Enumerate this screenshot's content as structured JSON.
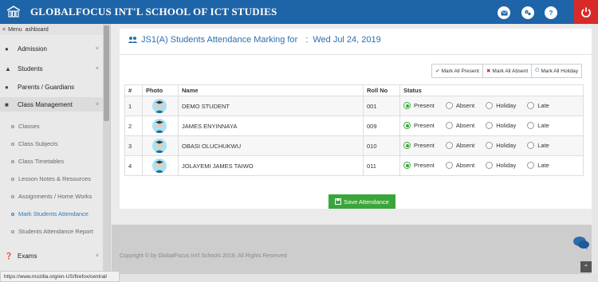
{
  "topbar": {
    "school_name": "GLOBALFOCUS INT'L SCHOOL OF ICT STUDIES",
    "icons": [
      "mail-icon",
      "settings-icon",
      "help-icon",
      "power-icon"
    ],
    "help_glyph": "?"
  },
  "sidebar": {
    "menu_label": "Menu",
    "menu_partial": "ashboard",
    "items": [
      {
        "label": "Admission",
        "icon": "user-icon",
        "has_arrow": true
      },
      {
        "label": "Students",
        "icon": "graduation-cap-icon",
        "has_arrow": true
      },
      {
        "label": "Parents / Guardians",
        "icon": "users-icon",
        "has_arrow": false
      },
      {
        "label": "Class Management",
        "icon": "sitemap-icon",
        "has_arrow": true
      },
      {
        "label": "Exams",
        "icon": "question-icon",
        "has_arrow": true
      }
    ],
    "subitems": [
      {
        "label": "Classes"
      },
      {
        "label": "Class Subjects"
      },
      {
        "label": "Class Timetables"
      },
      {
        "label": "Lesson Notes & Resources"
      },
      {
        "label": "Assignments / Home Works"
      },
      {
        "label": "Mark Students Attendance",
        "active": true
      },
      {
        "label": "Students Attendance Report"
      }
    ]
  },
  "page": {
    "title": "JS1(A) Students Attendance Marking for",
    "title_sep": ":",
    "date": "Wed Jul 24, 2019"
  },
  "mark_buttons": {
    "present": "Mark All Present",
    "absent": "Mark All Absent",
    "holiday": "Mark All Holiday"
  },
  "table": {
    "headers": [
      "#",
      "Photo",
      "Name",
      "Roll No",
      "Status"
    ],
    "status_options": [
      "Present",
      "Absent",
      "Holiday",
      "Late"
    ],
    "rows": [
      {
        "num": "1",
        "name": "DEMO STUDENT",
        "roll": "001",
        "status": "Present"
      },
      {
        "num": "2",
        "name": "JAMES ENYINNAYA",
        "roll": "009",
        "status": "Present"
      },
      {
        "num": "3",
        "name": "OBASI OLUCHUKWU",
        "roll": "010",
        "status": "Present"
      },
      {
        "num": "4",
        "name": "JOLAYEMI JAMES TAIWO",
        "roll": "011",
        "status": "Present"
      }
    ]
  },
  "save_button": "Save Attendance",
  "footer": {
    "copyright": "Copyright © by GlobalFocus Int'l Schools 2019. All Rights Reserved"
  },
  "statusbar": {
    "url": "https://www.mozilla.org/en-US/firefox/central/"
  },
  "colors": {
    "topbar": "#1e64a8",
    "power": "#d92a2a",
    "save": "#3aa63a",
    "accent": "#2a7ac6"
  }
}
